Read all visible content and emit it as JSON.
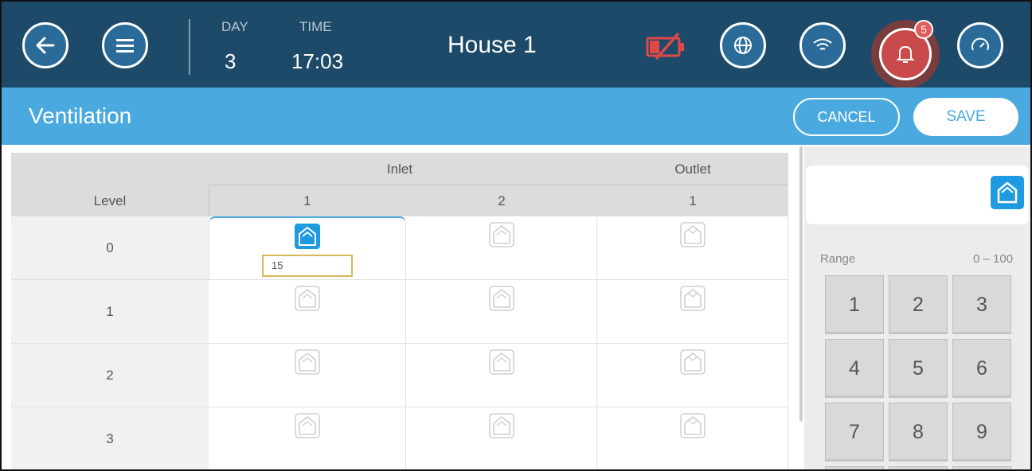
{
  "header": {
    "day_label": "DAY",
    "day_value": "3",
    "time_label": "TIME",
    "time_value": "17:03",
    "house": "House 1",
    "notification_count": "5",
    "icons": [
      "back-arrow-icon",
      "menu-icon",
      "battery-low-icon",
      "globe-icon",
      "wifi-icon",
      "bell-icon",
      "gauge-icon"
    ],
    "colors": {
      "topbar": "#1e4a6a",
      "alarm": "#c94a4a"
    }
  },
  "titlebar": {
    "title": "Ventilation",
    "cancel": "CANCEL",
    "save": "SAVE",
    "color": "#4aa9de"
  },
  "table": {
    "level_header": "Level",
    "groups": [
      "Inlet",
      "Outlet"
    ],
    "columns": [
      "1",
      "2",
      "1"
    ],
    "rows": [
      {
        "level": "0",
        "cells": [
          "open",
          "closed",
          "closed"
        ]
      },
      {
        "level": "1",
        "cells": [
          "closed",
          "closed",
          "closed"
        ]
      },
      {
        "level": "2",
        "cells": [
          "closed",
          "closed",
          "closed"
        ]
      },
      {
        "level": "3",
        "cells": [
          "closed",
          "closed",
          "closed"
        ]
      }
    ],
    "selected_value": "15"
  },
  "keypad": {
    "range_label": "Range",
    "range_value": "0  –  100",
    "keys": [
      "1",
      "2",
      "3",
      "4",
      "5",
      "6",
      "7",
      "8",
      "9"
    ]
  }
}
